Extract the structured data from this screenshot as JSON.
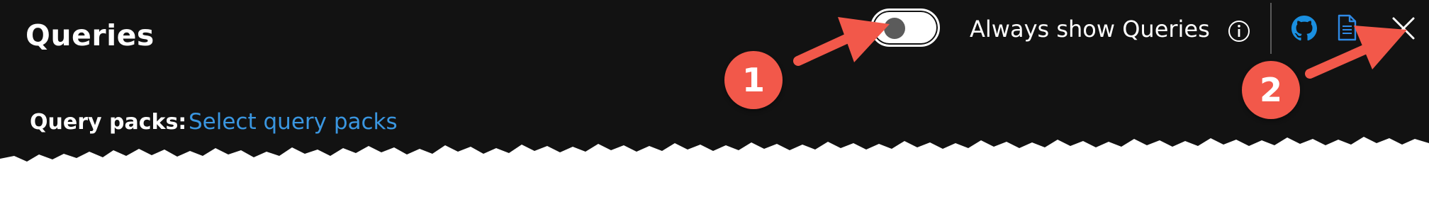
{
  "panel": {
    "title": "Queries",
    "query_packs_label": "Query packs:",
    "query_packs_link": "Select query packs"
  },
  "toolbar": {
    "toggle_label": "Always show Queries",
    "toggle_state": "off",
    "icons": [
      "info-icon",
      "github-icon",
      "document-icon",
      "close-icon"
    ]
  },
  "annotations": {
    "callout_1": "1",
    "callout_2": "2"
  },
  "colors": {
    "panel_background": "#121212",
    "link": "#3a96e0",
    "github_icon": "#1a8fe0",
    "document_icon": "#2f8ae6",
    "callout": "#f2584a"
  }
}
